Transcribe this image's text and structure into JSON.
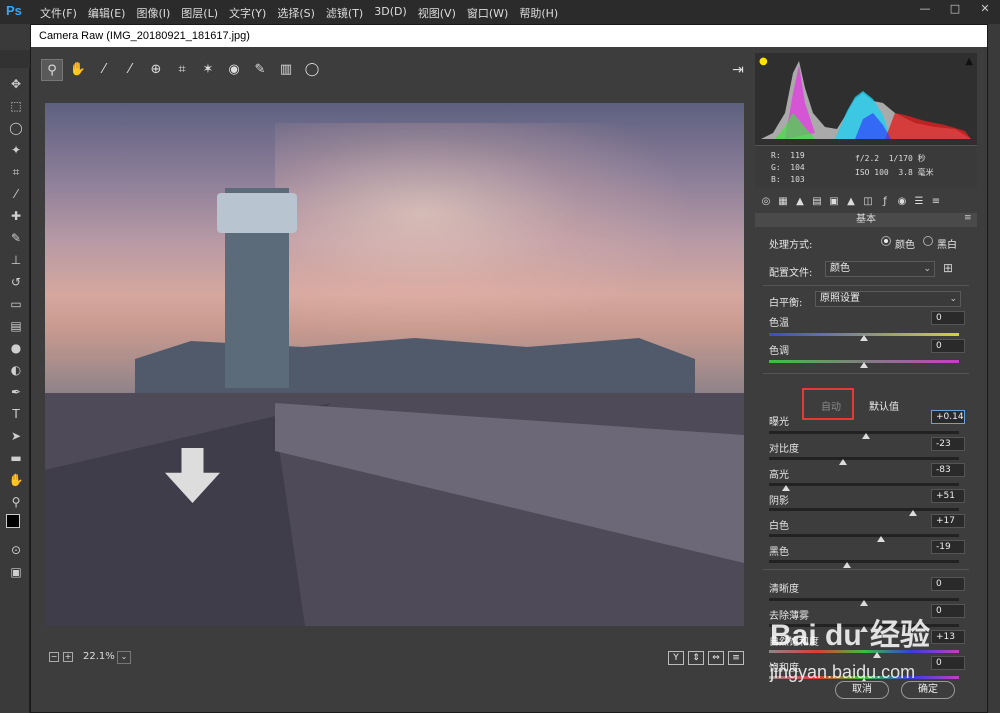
{
  "app": {
    "logo": "Ps"
  },
  "menu": [
    "文件(F)",
    "编辑(E)",
    "图像(I)",
    "图层(L)",
    "文字(Y)",
    "选择(S)",
    "滤镜(T)",
    "3D(D)",
    "视图(V)",
    "窗口(W)",
    "帮助(H)"
  ],
  "window_controls": {
    "minimize": "—",
    "maximize": "□",
    "close": "✕"
  },
  "camera_raw": {
    "title": "Camera Raw (IMG_20180921_181617.jpg)",
    "tools": [
      "zoom-icon",
      "hand-icon",
      "white-balance-icon",
      "color-sampler-icon",
      "target-adjust-icon",
      "crop-icon",
      "spot-removal-icon",
      "red-eye-icon",
      "brush-icon",
      "graduated-filter-icon",
      "radial-filter-icon"
    ],
    "zoom": {
      "minus": "−",
      "plus": "+",
      "value": "22.1%",
      "dropdown": "⌄"
    },
    "view_buttons": [
      "Y",
      "⇕",
      "⇔",
      "≡"
    ]
  },
  "histogram": {
    "rgb": {
      "r_label": "R:",
      "r": "119",
      "g_label": "G:",
      "g": "104",
      "b_label": "B:",
      "b": "103"
    },
    "camera": {
      "aperture": "f/2.2",
      "shutter": "1/170 秒",
      "iso": "ISO 100",
      "focal": "3.8 毫米"
    }
  },
  "panel": {
    "tab_icons": [
      "aperture-icon",
      "grid-icon",
      "mountain-icon",
      "hsl-icon",
      "split-tone-icon",
      "detail-icon",
      "lens-icon",
      "fx-icon",
      "camera-icon",
      "presets-icon",
      "sliders-icon"
    ],
    "title": "基本",
    "treatment": {
      "label": "处理方式:",
      "color": "颜色",
      "bw": "黑白",
      "selected": "color"
    },
    "profile": {
      "label": "配置文件:",
      "value": "颜色"
    },
    "white_balance": {
      "label": "白平衡:",
      "value": "原照设置"
    },
    "temp": {
      "label": "色温",
      "value": "0"
    },
    "tint": {
      "label": "色调",
      "value": "0"
    },
    "auto": "自动",
    "default": "默认值",
    "exposure": {
      "label": "曝光",
      "value": "+0.14",
      "level": 0.51
    },
    "contrast": {
      "label": "对比度",
      "value": "-23",
      "level": 0.39
    },
    "highlights": {
      "label": "高光",
      "value": "-83",
      "level": 0.09
    },
    "shadows": {
      "label": "阴影",
      "value": "+51",
      "level": 0.76
    },
    "whites": {
      "label": "白色",
      "value": "+17",
      "level": 0.59
    },
    "blacks": {
      "label": "黑色",
      "value": "-19",
      "level": 0.41
    },
    "clarity": {
      "label": "清晰度",
      "value": "0",
      "level": 0.5
    },
    "dehaze": {
      "label": "去除薄雾",
      "value": "0",
      "level": 0.5
    },
    "vibrance": {
      "label": "自然饱和度",
      "value": "+13",
      "level": 0.57
    },
    "saturation": {
      "label": "饱和度",
      "value": "0",
      "level": 0.5
    }
  },
  "buttons": {
    "cancel": "取消",
    "ok": "确定"
  },
  "watermark": {
    "brand": "Bai du 经验",
    "url": "jingyan.baidu.com"
  }
}
